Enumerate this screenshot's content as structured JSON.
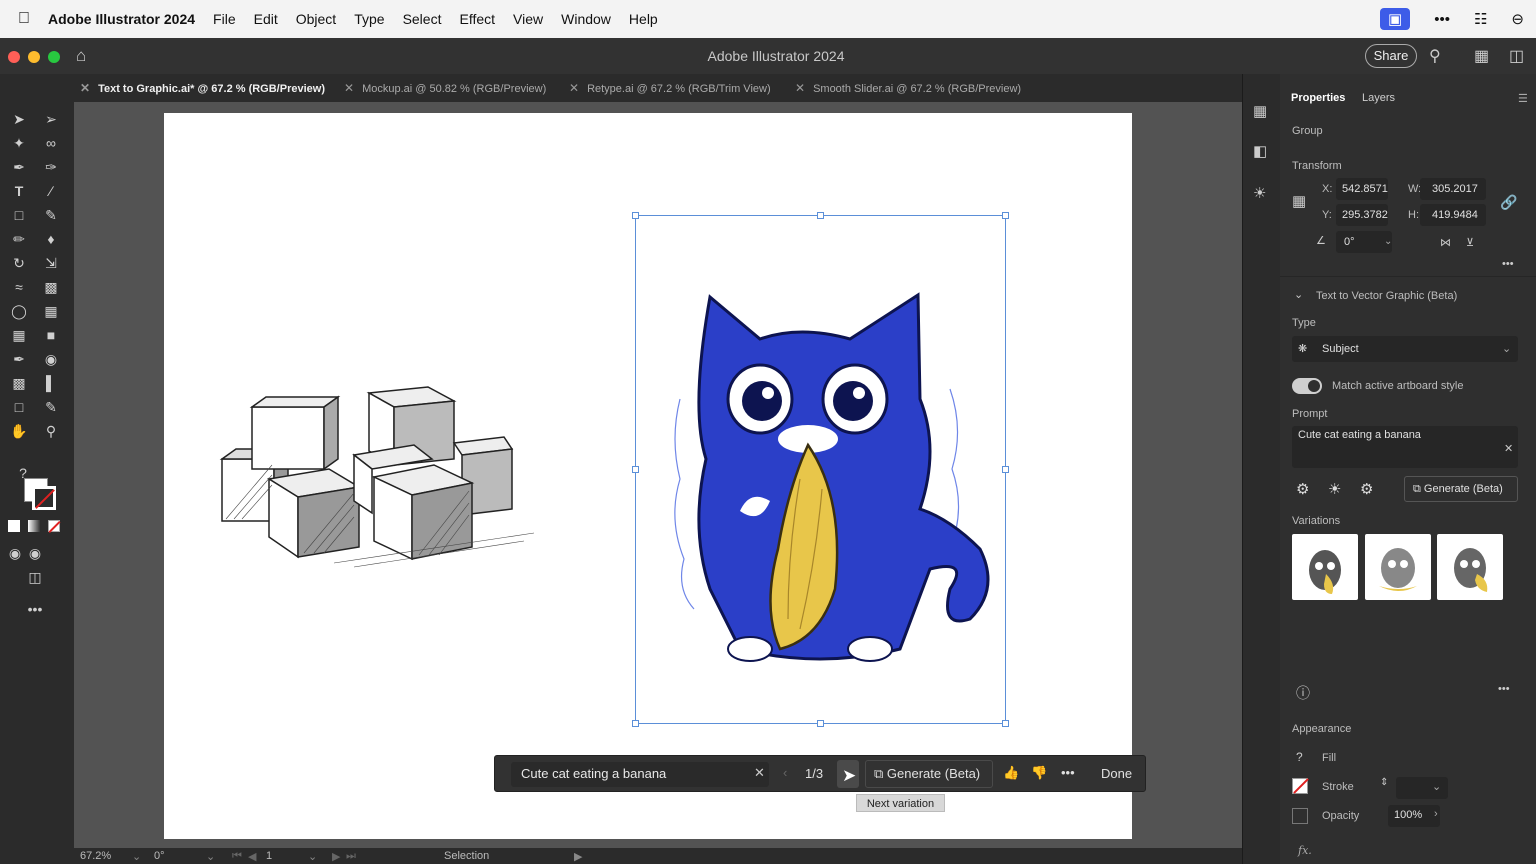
{
  "menubar": {
    "app_name": "Adobe Illustrator 2024",
    "menus": [
      "File",
      "Edit",
      "Object",
      "Type",
      "Select",
      "Effect",
      "View",
      "Window",
      "Help"
    ]
  },
  "titlebar": {
    "title": "Adobe Illustrator 2024",
    "share_label": "Share"
  },
  "tabs": [
    {
      "label": "Text to Graphic.ai* @ 67.2 % (RGB/Preview)",
      "active": true
    },
    {
      "label": "Mockup.ai @ 50.82 % (RGB/Preview)",
      "active": false
    },
    {
      "label": "Retype.ai @ 67.2 % (RGB/Trim View)",
      "active": false
    },
    {
      "label": "Smooth Slider.ai @ 67.2 % (RGB/Preview)",
      "active": false
    }
  ],
  "panel": {
    "tab_properties": "Properties",
    "tab_layers": "Layers",
    "group_label": "Group",
    "transform_label": "Transform",
    "x_label": "X:",
    "x_value": "542.8571",
    "y_label": "Y:",
    "y_value": "295.3782",
    "w_label": "W:",
    "w_value": "305.2017",
    "h_label": "H:",
    "h_value": "419.9484",
    "angle_value": "0°",
    "t2v_section": "Text to Vector Graphic (Beta)",
    "type_label": "Type",
    "type_value": "Subject",
    "match_style_label": "Match active artboard style",
    "prompt_label": "Prompt",
    "prompt_value": "Cute cat eating a banana",
    "generate_label": "Generate (Beta)",
    "variations_label": "Variations",
    "appearance_label": "Appearance",
    "fill_label": "Fill",
    "stroke_label": "Stroke",
    "opacity_label": "Opacity",
    "opacity_value": "100%",
    "fx_label": "fx."
  },
  "ctxbar": {
    "prompt_value": "Cute cat eating a banana",
    "counter": "1/3",
    "generate_label": "Generate (Beta)",
    "done_label": "Done",
    "tooltip": "Next variation"
  },
  "statusbar": {
    "zoom": "67.2%",
    "rotation": "0°",
    "artboard_num": "1",
    "tool_name": "Selection"
  },
  "colors": {
    "accent": "#3d5ce8",
    "selection": "#5b8fd8",
    "cat_blue": "#2b3fc8",
    "banana_yellow": "#e8c64a"
  }
}
